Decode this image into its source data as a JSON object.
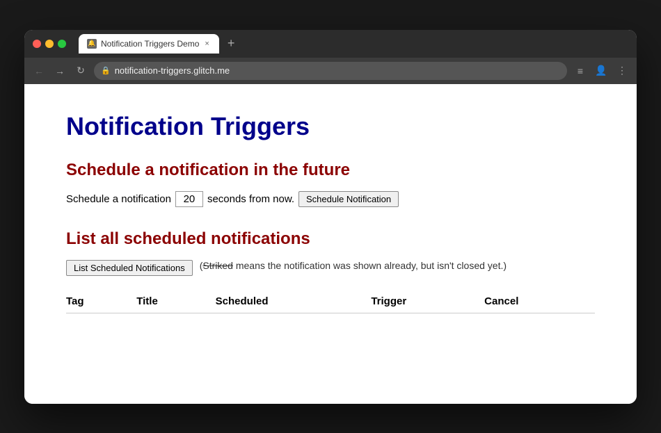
{
  "browser": {
    "url": "notification-triggers.glitch.me",
    "tab_title": "Notification Triggers Demo",
    "tab_favicon": "🔔"
  },
  "page": {
    "title": "Notification Triggers",
    "section1": {
      "heading": "Schedule a notification in the future",
      "label_before": "Schedule a notification",
      "seconds_value": "20",
      "label_after": "seconds from now.",
      "button_label": "Schedule Notification"
    },
    "section2": {
      "heading": "List all scheduled notifications",
      "button_label": "List Scheduled Notifications",
      "note_prefix": "(",
      "note_strike": "Striked",
      "note_suffix": " means the notification was shown already, but isn't closed yet.)"
    },
    "table": {
      "columns": [
        "Tag",
        "Title",
        "Scheduled",
        "Trigger",
        "Cancel"
      ],
      "rows": []
    }
  },
  "icons": {
    "back": "←",
    "forward": "→",
    "reload": "↻",
    "lock": "🔒",
    "menu": "≡",
    "profile": "👤",
    "more": "⋮",
    "close": "×",
    "new_tab": "+"
  }
}
